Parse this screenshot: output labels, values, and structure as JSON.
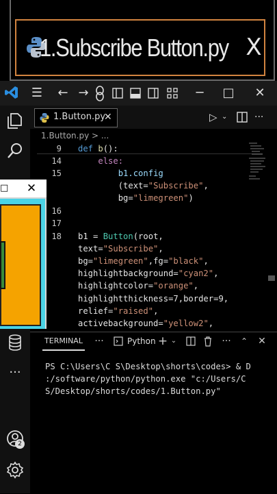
{
  "banner": {
    "tab_title": "1.Subscribe Button.py",
    "close_glyph": "X"
  },
  "titlebar": {
    "icons": [
      "vscode-logo",
      "menu-icon",
      "back-arrow",
      "forward-arrow",
      "copilot-icon",
      "layout-sidebar",
      "layout-panel",
      "layout-custom"
    ],
    "window_controls": [
      "─",
      "□",
      "✕"
    ]
  },
  "activity_bar": {
    "icons": [
      "explorer-icon",
      "search-icon",
      "database-icon",
      "more-icon",
      "account-icon",
      "settings-icon"
    ],
    "account_badge": "2"
  },
  "editor": {
    "tab_label": "1.Button.py",
    "tab_close": "✕",
    "breadcrumb": "1.Button.py > ...",
    "run_glyph": "▷",
    "more_glyph": "···",
    "lines": {
      "l9_num": "9",
      "l9_kw": "def ",
      "l9_fn": "b",
      "l9_rest": "():",
      "l14_num": "14",
      "l14_kw": "else:",
      "l15_num": "15",
      "l15_a": "b1.config",
      "l15b_a": "(text=",
      "l15b_s": "\"Subscribe\"",
      "l15b_c": ",",
      "l15c_a": "bg=",
      "l15c_s": "\"limegreen\"",
      "l15c_c": ")",
      "l16_num": "16",
      "l17_num": "17",
      "l18_num": "18",
      "l18_a": "b1 = ",
      "l18_fn": "Button",
      "l18_b": "(root,",
      "l18b_a": "text=",
      "l18b_s": "\"Subscribe\"",
      "l18b_c": ",",
      "l18c_a": "bg=",
      "l18c_s": "\"limegreen\"",
      "l18c_b": ",fg=",
      "l18c_s2": "\"black\"",
      "l18c_c": ",",
      "l18d_a": "highlightbackground=",
      "l18d_s": "\"cyan2\"",
      "l18d_c": ",",
      "l18e_a": "highlightcolor=",
      "l18e_s": "\"orange\"",
      "l18e_c": ",",
      "l18f_a": "highlightthickness=7,border=9,",
      "l18g_a": "relief=",
      "l18g_s": "\"raised\"",
      "l18g_c": ",",
      "l18h_a": "activebackground=",
      "l18h_s": "\"yellow2\"",
      "l18h_c": ","
    }
  },
  "tk_window": {
    "min_glyph": "□",
    "close_glyph": "✕"
  },
  "panel": {
    "terminal_tab": "TERMINAL",
    "more_glyph": "···",
    "python_label": "Python",
    "add_glyph": "+",
    "close_glyph": "✕",
    "prompt_line1": "PS C:\\Users\\C S\\Desktop\\shorts\\codes> & D",
    "prompt_line2": ":/software/python/python.exe \"c:/Users/C",
    "prompt_line3": "S/Desktop/shorts/codes/1.Button.py\""
  },
  "colors": {
    "keyword": "#569cd6",
    "function": "#dcdcaa",
    "string": "#ce9178",
    "tab_border": "#d28440",
    "tk_button_bg": "#f5a300",
    "tk_highlight": "#4ad3e6"
  }
}
